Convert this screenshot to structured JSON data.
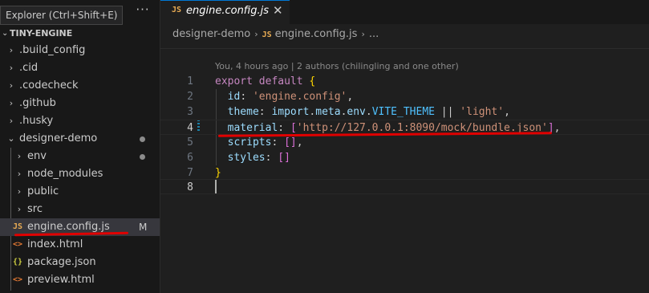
{
  "sidebar": {
    "tooltip": "Explorer (Ctrl+Shift+E)",
    "more_icon": "ellipsis-icon",
    "project_name": "TINY-ENGINE",
    "items": [
      {
        "label": ".build_config",
        "type": "folder"
      },
      {
        "label": ".cid",
        "type": "folder"
      },
      {
        "label": ".codecheck",
        "type": "folder"
      },
      {
        "label": ".github",
        "type": "folder"
      },
      {
        "label": ".husky",
        "type": "folder"
      },
      {
        "label": "designer-demo",
        "type": "folder-open"
      },
      {
        "label": "env",
        "type": "folder"
      },
      {
        "label": "node_modules",
        "type": "folder"
      },
      {
        "label": "public",
        "type": "folder"
      },
      {
        "label": "src",
        "type": "folder"
      },
      {
        "label": "engine.config.js",
        "type": "js",
        "badge": "M"
      },
      {
        "label": "index.html",
        "type": "html"
      },
      {
        "label": "package.json",
        "type": "json"
      },
      {
        "label": "preview.html",
        "type": "html"
      }
    ],
    "icons": {
      "js": "JS",
      "html": "<>",
      "json": "{}"
    }
  },
  "editor": {
    "tab": {
      "icon": "JS",
      "name": "engine.config.js",
      "close": "✕"
    },
    "breadcrumb": {
      "folder": "designer-demo",
      "icon": "JS",
      "file": "engine.config.js",
      "tail": "..."
    },
    "blame": "You, 4 hours ago | 2 authors (chilingling and one other)",
    "line_numbers": [
      "1",
      "2",
      "3",
      "4",
      "5",
      "6",
      "7",
      "8"
    ],
    "lines": {
      "l1": {
        "kw": "export default",
        "brace": "{"
      },
      "l2": {
        "prop": "id",
        "colon": ": ",
        "str": "'engine.config'",
        "comma": ","
      },
      "l3": {
        "prop": "theme",
        "colon": ": ",
        "v1": "import",
        "dot1": ".",
        "v2": "meta",
        "dot2": ".",
        "v3": "env",
        "dot3": ".",
        "const": "VITE_THEME",
        "op": " || ",
        "str": "'light'",
        "comma": ","
      },
      "l4": {
        "prop": "material",
        "colon": ": ",
        "open": "[",
        "str": "'http://127.0.0.1:8090/mock/bundle.json'",
        "close": "]",
        "comma": ","
      },
      "l5": {
        "prop": "scripts",
        "colon": ": ",
        "arr": "[]",
        "comma": ","
      },
      "l6": {
        "prop": "styles",
        "colon": ": ",
        "arr": "[]"
      },
      "l7": {
        "brace": "}"
      },
      "l8": {
        "text": ""
      }
    }
  },
  "colors": {
    "accent": "#0078d4",
    "annotation": "#e00000",
    "js_icon": "#e8ab53",
    "html_icon": "#e37933",
    "json_icon": "#cbcb41"
  }
}
